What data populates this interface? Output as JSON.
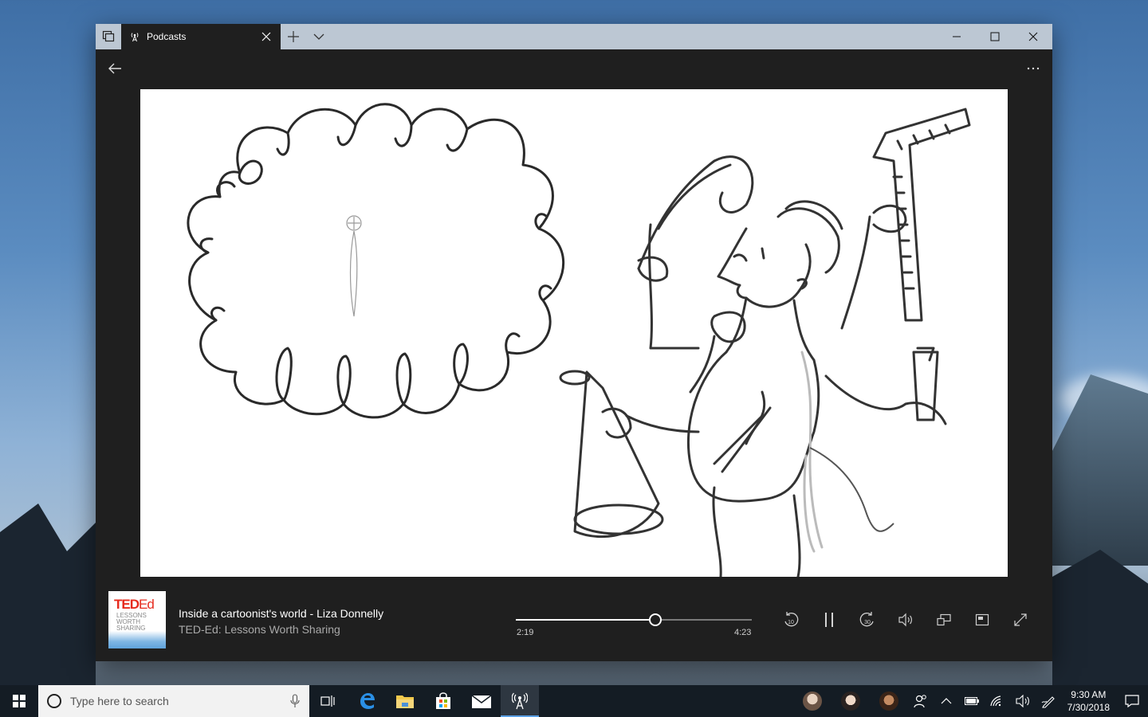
{
  "window": {
    "tab_title": "Podcasts"
  },
  "player": {
    "episode_title": "Inside a cartoonist's world - Liza Donnelly",
    "show_name": "TED-Ed: Lessons Worth Sharing",
    "current_time": "2:19",
    "duration": "4:23",
    "progress_fraction": 0.59,
    "skip_back_label": "10",
    "skip_forward_label": "30",
    "artwork": {
      "brand": "TED",
      "brand_suffix": "Ed",
      "tagline_lines": [
        "LESSONS",
        "WORTH",
        "SHARING"
      ]
    }
  },
  "taskbar": {
    "search_placeholder": "Type here to search",
    "clock_time": "9:30 AM",
    "clock_date": "7/30/2018"
  },
  "colors": {
    "window_bg": "#1f1f1f",
    "titlebar_bg": "#bcc7d3",
    "ted_red": "#e62b1e",
    "taskbar_bg": "#141c24",
    "active_indicator": "#5aa0e6"
  }
}
